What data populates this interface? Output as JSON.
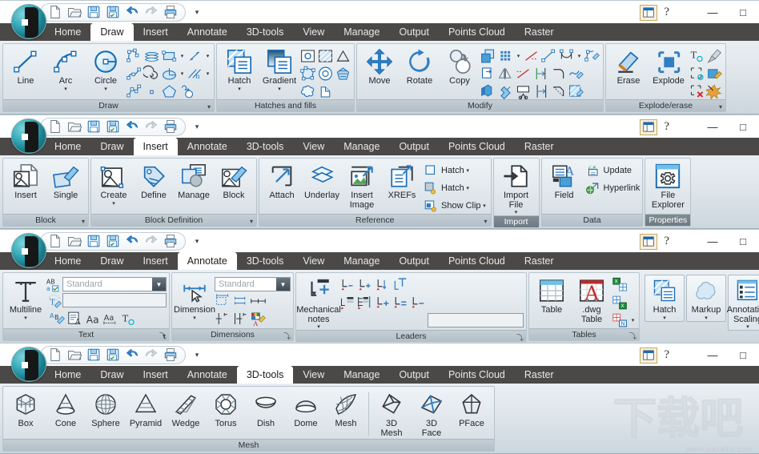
{
  "window": {
    "quick_access": [
      {
        "name": "new-icon",
        "tip": "New"
      },
      {
        "name": "open-icon",
        "tip": "Open"
      },
      {
        "name": "save-icon",
        "tip": "Save"
      },
      {
        "name": "save-as-icon",
        "tip": "Save As"
      },
      {
        "name": "undo-icon",
        "tip": "Undo"
      },
      {
        "name": "redo-icon",
        "tip": "Redo"
      },
      {
        "name": "print-icon",
        "tip": "Print"
      }
    ],
    "qat_overflow_label": "▾",
    "workspace_icon": "workspace-icon",
    "help_label": "?",
    "minimize_label": "—",
    "maximize_label": "□"
  },
  "tabs": [
    "Home",
    "Draw",
    "Insert",
    "Annotate",
    "3D-tools",
    "View",
    "Manage",
    "Output",
    "Points Cloud",
    "Raster"
  ],
  "ribbons": [
    {
      "active_tab": "Draw",
      "panels": [
        {
          "title": "Draw",
          "has_dropdown": true,
          "big": [
            {
              "label": "Line",
              "icon": "line-icon",
              "caret": false
            },
            {
              "label": "Arc",
              "icon": "arc-icon",
              "caret": true
            },
            {
              "label": "Circle",
              "icon": "circle-icon",
              "caret": true
            }
          ],
          "small_rows": [
            [
              {
                "icon": "polyline-icon"
              },
              {
                "icon": "multiline-icon"
              },
              {
                "icon": "rectangle-icon",
                "caret": true
              },
              {
                "icon": "dimension-line-icon",
                "caret": true
              }
            ],
            [
              {
                "icon": "spline-icon"
              },
              {
                "icon": "spiral-icon"
              },
              {
                "icon": "ellipse-icon",
                "caret": true
              },
              {
                "icon": "construction-line-icon",
                "caret": true
              }
            ],
            [
              {
                "icon": "polygon-path-icon"
              },
              {
                "icon": "point-icon"
              },
              {
                "icon": "polygon-icon"
              },
              {
                "icon": "revision-cloud-icon"
              }
            ]
          ]
        },
        {
          "title": "Hatches and fills",
          "has_dropdown": false,
          "big": [
            {
              "label": "Hatch",
              "icon": "hatch-icon",
              "caret": true
            },
            {
              "label": "Gradient",
              "icon": "gradient-icon",
              "caret": true
            }
          ],
          "small_rows": [
            [
              {
                "icon": "hatch-setting-icon"
              },
              {
                "icon": "hatch-pattern-icon"
              },
              {
                "icon": "triangle-fill-icon"
              }
            ],
            [
              {
                "icon": "boundary-icon"
              },
              {
                "icon": "donut-icon"
              },
              {
                "icon": "solid-fill-icon"
              }
            ],
            [
              {
                "icon": "region-icon"
              },
              {
                "icon": "wipeout-icon"
              }
            ]
          ]
        },
        {
          "title": "Modify",
          "has_dropdown": false,
          "big": [
            {
              "label": "Move",
              "icon": "move-icon",
              "caret": false
            },
            {
              "label": "Rotate",
              "icon": "rotate-icon",
              "caret": false
            },
            {
              "label": "Copy",
              "icon": "copy-icon",
              "caret": false
            }
          ],
          "small_rows": [
            [
              {
                "icon": "scale-icon"
              },
              {
                "icon": "array-icon",
                "caret": true
              },
              {
                "icon": "trim-icon"
              },
              {
                "icon": "stretch-icon"
              },
              {
                "icon": "offset-icon",
                "caret": true
              },
              {
                "icon": "edit-polyline-icon"
              }
            ],
            [
              {
                "icon": "align-icon"
              },
              {
                "icon": "mirror-icon"
              },
              {
                "icon": "extend-icon"
              },
              {
                "icon": "lengthen-icon"
              },
              {
                "icon": "fillet-icon"
              },
              {
                "icon": "edit-spline-icon"
              }
            ],
            [
              {
                "icon": "3d-move-icon"
              },
              {
                "icon": "join-icon"
              },
              {
                "icon": "split-icon"
              },
              {
                "icon": "break-icon"
              },
              {
                "icon": "chamfer-icon"
              },
              {
                "icon": "edit-hatch-icon"
              }
            ]
          ]
        },
        {
          "title": "Explode/erase",
          "has_dropdown": true,
          "big": [
            {
              "label": "Erase",
              "icon": "erase-icon",
              "caret": false
            },
            {
              "label": "Explode",
              "icon": "explode-icon",
              "caret": false
            }
          ],
          "small_rows": [
            [
              {
                "icon": "text-explode-icon"
              },
              {
                "icon": "purge-icon"
              }
            ],
            [
              {
                "icon": "block-explode-icon"
              },
              {
                "icon": "edit-attribute-icon"
              }
            ],
            [
              {
                "icon": "delete-duplicate-icon"
              },
              {
                "icon": "burst-icon"
              }
            ]
          ]
        }
      ]
    },
    {
      "active_tab": "Insert",
      "panels": [
        {
          "title": "Block",
          "has_dropdown": true,
          "big": [
            {
              "label": "Insert",
              "icon": "insert-block-icon",
              "caret": false
            },
            {
              "label": "Single",
              "icon": "single-block-icon",
              "caret": false
            }
          ],
          "small_rows": []
        },
        {
          "title": "Block Definition",
          "has_dropdown": true,
          "big": [
            {
              "label": "Create",
              "icon": "create-block-icon",
              "caret": true
            },
            {
              "label": "Define",
              "icon": "define-attribute-icon",
              "caret": false
            },
            {
              "label": "Manage",
              "icon": "manage-attribute-icon",
              "caret": false
            },
            {
              "label": "Block",
              "icon": "block-editor-icon",
              "caret": false
            }
          ],
          "small_rows": []
        },
        {
          "title": "Reference",
          "has_dropdown": true,
          "big": [
            {
              "label": "Attach",
              "icon": "attach-icon",
              "caret": false
            },
            {
              "label": "Underlay",
              "icon": "underlay-icon",
              "caret": false
            },
            {
              "label": "Insert\nImage",
              "icon": "insert-image-icon",
              "caret": false
            },
            {
              "label": "XREFs",
              "icon": "xrefs-icon",
              "caret": false
            }
          ],
          "label_rows": [
            {
              "icon": "clip-hatch-icon",
              "text": "Hatch",
              "caret": true
            },
            {
              "icon": "frame-hatch-icon",
              "text": "Hatch",
              "caret": true
            },
            {
              "icon": "show-clip-icon",
              "text": "Show Clip",
              "caret": true
            }
          ]
        },
        {
          "title": "Import",
          "title_selected": true,
          "has_dropdown": false,
          "big": [
            {
              "label": "Import\nFile",
              "icon": "import-file-icon",
              "caret": true
            }
          ],
          "small_rows": []
        },
        {
          "title": "Data",
          "has_dropdown": false,
          "big": [
            {
              "label": "Field",
              "icon": "field-icon",
              "caret": false
            }
          ],
          "label_rows": [
            {
              "icon": "update-icon",
              "text": "Update",
              "caret": false
            },
            {
              "icon": "hyperlink-icon",
              "text": "Hyperlink",
              "caret": false
            }
          ]
        },
        {
          "title": "Properties",
          "title_selected": true,
          "has_dropdown": false,
          "big": [
            {
              "label": "File\nExplorer",
              "icon": "file-explorer-icon",
              "caret": false
            }
          ],
          "small_rows": []
        }
      ]
    },
    {
      "active_tab": "Annotate",
      "panels": [
        {
          "title": "Text",
          "has_dropdown": true,
          "has_dialog_launcher": true,
          "big": [
            {
              "label": "Multiline",
              "icon": "multiline-text-icon",
              "caret": true
            }
          ],
          "combo_value": "Standard",
          "small_rows": [
            [
              {
                "icon": "spell-check-icon"
              },
              {
                "icon": "find-text-icon"
              }
            ],
            [
              {
                "icon": "text-style-icon"
              },
              {
                "icon": "scale-text-icon"
              },
              {
                "icon": "font-icon"
              },
              {
                "icon": "justify-text-icon"
              },
              {
                "icon": "annotative-text-icon"
              }
            ]
          ]
        },
        {
          "title": "Dimensions",
          "has_dropdown": false,
          "has_dialog_launcher": true,
          "big": [
            {
              "label": "Dimension",
              "icon": "dimension-icon",
              "caret": true
            }
          ],
          "combo_value": "Standard",
          "small_rows": [
            [
              {
                "icon": "quick-dimension-icon"
              },
              {
                "icon": "baseline-dimension-icon"
              },
              {
                "icon": "continue-dimension-icon"
              }
            ],
            [
              {
                "icon": "break-dimension-icon"
              },
              {
                "icon": "adjust-space-icon"
              },
              {
                "icon": "dimension-style-icon"
              }
            ]
          ]
        },
        {
          "title": "Leaders",
          "has_dropdown": false,
          "has_dialog_launcher": true,
          "big": [
            {
              "label": "Mechanical\nnotes",
              "icon": "mechanical-notes-icon",
              "caret": true
            }
          ],
          "small_rows": [
            [
              {
                "icon": "leader-remove-icon"
              },
              {
                "icon": "leader-add-icon"
              },
              {
                "icon": "leader-align-icon"
              },
              {
                "icon": "leader-text-icon"
              }
            ],
            [
              {
                "icon": "leader-multi-icon"
              },
              {
                "icon": "leader-collect-icon"
              },
              {
                "icon": "leader-plus-icon"
              },
              {
                "icon": "leader-equal-icon"
              },
              {
                "icon": "leader-minus-icon"
              }
            ]
          ],
          "has_blank_box": true
        },
        {
          "title": "Tables",
          "has_dropdown": false,
          "has_dialog_launcher": true,
          "big": [
            {
              "label": "Table",
              "icon": "table-icon",
              "caret": false
            },
            {
              "label": ".dwg\nTable",
              "icon": "dwg-table-icon",
              "caret": false
            }
          ],
          "small_rows": [
            [
              {
                "icon": "export-excel-icon"
              }
            ],
            [
              {
                "icon": "import-excel-icon"
              }
            ],
            [
              {
                "icon": "link-data-icon",
                "caret": true
              }
            ]
          ]
        },
        {
          "title": "",
          "framed_big": [
            {
              "label": "Hatch",
              "icon": "hatch-annot-icon",
              "caret": true
            },
            {
              "label": "Markup",
              "icon": "markup-icon",
              "caret": true
            },
            {
              "label": "Annotation\nScaling",
              "icon": "annotation-scaling-icon",
              "caret": true
            }
          ]
        }
      ]
    },
    {
      "active_tab": "3D-tools",
      "panels": [
        {
          "title": "Mesh",
          "has_dropdown": false,
          "big": [
            {
              "label": "Box",
              "icon": "box-icon",
              "caret": false
            },
            {
              "label": "Cone",
              "icon": "cone-icon",
              "caret": false
            },
            {
              "label": "Sphere",
              "icon": "sphere-icon",
              "caret": false
            },
            {
              "label": "Pyramid",
              "icon": "pyramid-icon",
              "caret": false
            },
            {
              "label": "Wedge",
              "icon": "wedge-icon",
              "caret": false
            },
            {
              "label": "Torus",
              "icon": "torus-icon",
              "caret": false
            },
            {
              "label": "Dish",
              "icon": "dish-icon",
              "caret": false
            },
            {
              "label": "Dome",
              "icon": "dome-icon",
              "caret": false
            },
            {
              "label": "Mesh",
              "icon": "mesh-icon",
              "caret": false
            }
          ],
          "big_after_sep": [
            {
              "label": "3D\nMesh",
              "icon": "3d-mesh-icon",
              "caret": false
            },
            {
              "label": "3D\nFace",
              "icon": "3d-face-icon",
              "caret": false
            },
            {
              "label": "PFace",
              "icon": "pface-icon",
              "caret": false
            }
          ]
        }
      ]
    }
  ],
  "watermark": {
    "text": "下载吧",
    "url": "www.xiazaiba.com"
  }
}
